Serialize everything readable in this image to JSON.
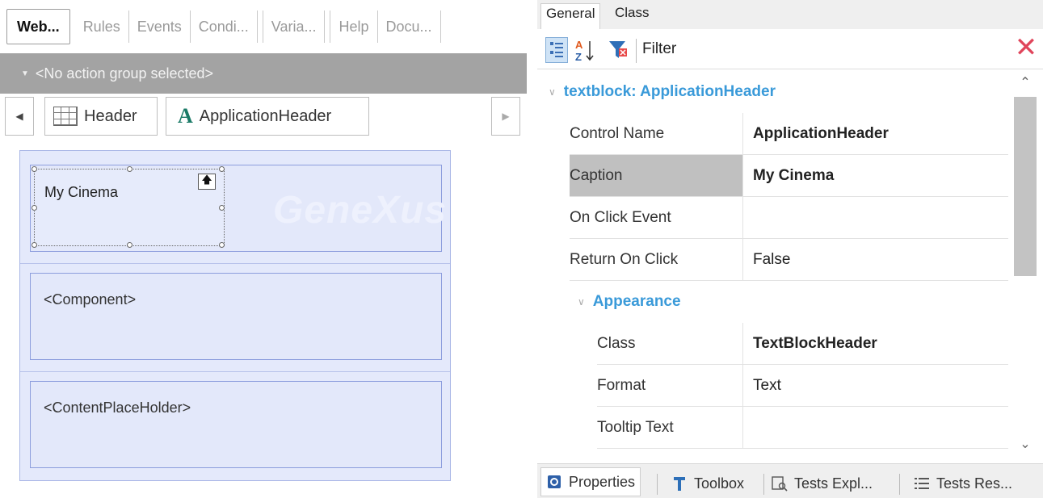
{
  "left": {
    "tabs": [
      "Web...",
      "Rules",
      "Events",
      "Condi...",
      "Varia...",
      "Help",
      "Docu..."
    ],
    "action_group": "<No action group selected>",
    "breadcrumb": {
      "item1": "Header",
      "item2": "ApplicationHeader"
    },
    "cells": {
      "header_text": "My Cinema",
      "watermark": "GeneXus",
      "component": "<Component>",
      "placeholder": "<ContentPlaceHolder>"
    }
  },
  "right": {
    "tabs": {
      "general": "General",
      "class": "Class"
    },
    "filter": "Filter",
    "category": "textblock: ApplicationHeader",
    "rows": [
      {
        "name": "Control Name",
        "value": "ApplicationHeader"
      },
      {
        "name": "Caption",
        "value": "My Cinema"
      },
      {
        "name": "On Click Event",
        "value": ""
      },
      {
        "name": "Return On Click",
        "value": "False"
      }
    ],
    "appearance_label": "Appearance",
    "appearance_rows": [
      {
        "name": "Class",
        "value": "TextBlockHeader"
      },
      {
        "name": "Format",
        "value": "Text"
      },
      {
        "name": "Tooltip Text",
        "value": ""
      }
    ],
    "bottom_tabs": [
      "Properties",
      "Toolbox",
      "Tests Expl...",
      "Tests Res..."
    ]
  },
  "colors": {
    "accent_blue": "#3a9ad9",
    "close_red": "#e0455b",
    "canvas_bg": "#e4e9fb",
    "action_bar": "#a3a3a3"
  },
  "icons": {
    "tabs_left_icons": [
      "chevron-left-icon",
      "chevron-right-icon",
      "grid-icon",
      "letter-a-icon",
      "up-arrow-icon"
    ],
    "toolbar_icons": [
      "categorized-icon",
      "sort-alpha-icon",
      "filter-icon",
      "close-icon"
    ],
    "bottom_icons": [
      "gear-icon",
      "hammer-icon",
      "test-explorer-icon",
      "test-results-icon"
    ]
  }
}
